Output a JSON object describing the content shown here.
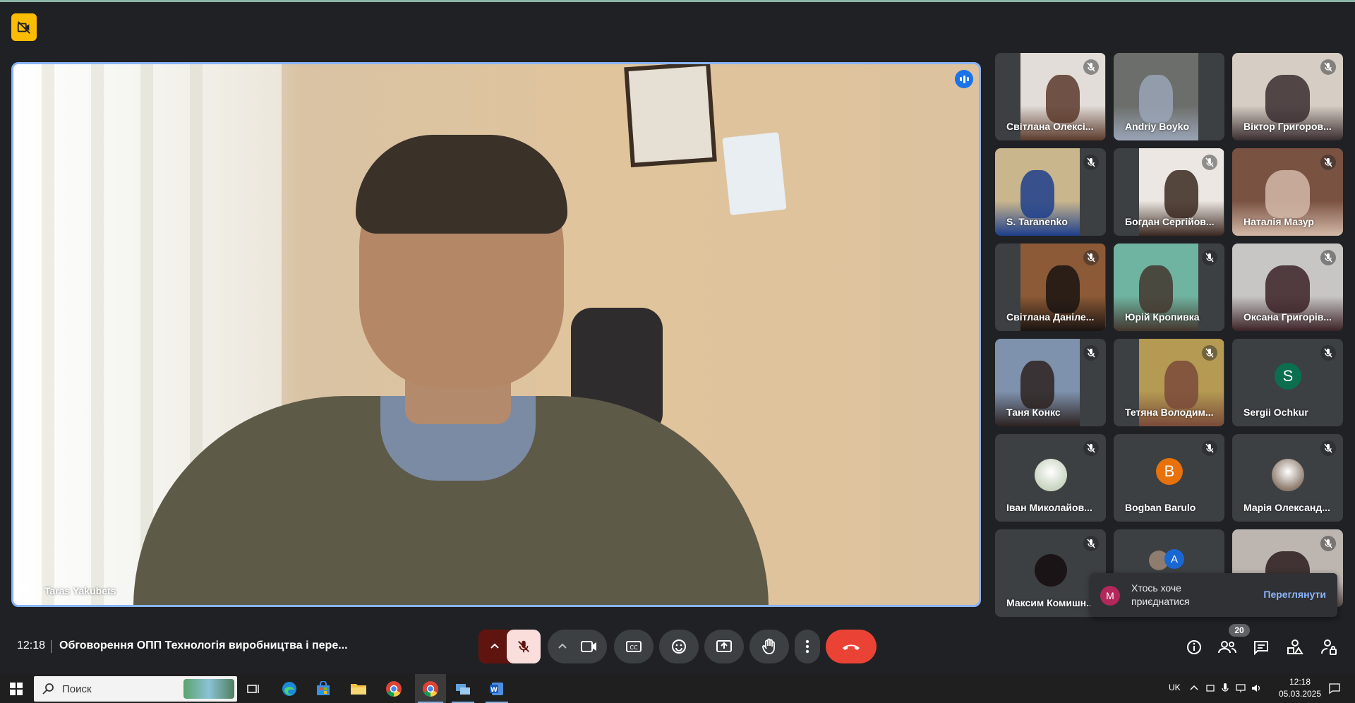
{
  "main_stage": {
    "speaker_name": "Taras Yakubets"
  },
  "participants": [
    {
      "name": "Світлана Олексі...",
      "type": "video",
      "muted": true,
      "bg": "#e2ddd8",
      "fg": "#5b3a2c"
    },
    {
      "name": "Andriy Boyko",
      "type": "video",
      "muted": false,
      "bg": "#6b6e6a",
      "fg": "#9aa4b6"
    },
    {
      "name": "Віктор Григоров...",
      "type": "video",
      "muted": true,
      "bg": "#d6cec4",
      "fg": "#3a2d30"
    },
    {
      "name": "S. Taranenko",
      "type": "video",
      "muted": true,
      "bg": "#c9b68d",
      "fg": "#1e3f8c"
    },
    {
      "name": "Богдан Сергійов...",
      "type": "video",
      "muted": true,
      "bg": "#ece7e2",
      "fg": "#3a2820"
    },
    {
      "name": "Наталія Мазур",
      "type": "video",
      "muted": true,
      "bg": "#7a5242",
      "fg": "#d4b9a8"
    },
    {
      "name": "Світлана Даніле...",
      "type": "video",
      "muted": true,
      "bg": "#8c5a36",
      "fg": "#1a1412"
    },
    {
      "name": "Юрій Кропивка",
      "type": "video",
      "muted": true,
      "bg": "#6fb4a0",
      "fg": "#44362e"
    },
    {
      "name": "Оксана Григорів...",
      "type": "video",
      "muted": true,
      "bg": "#c8c6c5",
      "fg": "#3b2226"
    },
    {
      "name": "Таня Конкс",
      "type": "video",
      "muted": true,
      "bg": "#7e92ad",
      "fg": "#2d2220"
    },
    {
      "name": "Тетяна Володим...",
      "type": "video",
      "muted": true,
      "bg": "#b49a52",
      "fg": "#7a4a3a"
    },
    {
      "name": "Sergii Ochkur",
      "type": "avatar",
      "muted": true,
      "letter": "S",
      "avatar_color": "#0b6e4f"
    },
    {
      "name": "Іван Миколайов...",
      "type": "photo",
      "muted": true,
      "avatar_color": "#c8d4c0"
    },
    {
      "name": "Bogban Barulo",
      "type": "avatar",
      "muted": true,
      "letter": "B",
      "avatar_color": "#e8710a"
    },
    {
      "name": "Марія Олександ...",
      "type": "photo",
      "muted": true,
      "avatar_color": "#8e7c6e"
    },
    {
      "name": "Максим Комишн...",
      "type": "photo",
      "muted": true,
      "avatar_color": "#1b1416"
    },
    {
      "name": "",
      "type": "group",
      "muted": false,
      "letter": "A",
      "avatar_color": "#1967d2"
    },
    {
      "name": "",
      "type": "video",
      "muted": true,
      "bg": "#bdb6b0",
      "fg": "#2b1c1e"
    }
  ],
  "toast": {
    "avatar_letter": "M",
    "message": "Хтось хоче приєднатися",
    "action": "Переглянути"
  },
  "bottom_bar": {
    "time": "12:18",
    "meeting_title": "Обговорення ОПП Технологія виробництва і пере...",
    "participant_count": "20"
  },
  "taskbar": {
    "search_placeholder": "Поиск",
    "language": "UK",
    "clock_time": "12:18",
    "clock_date": "05.03.2025"
  },
  "colors": {
    "accent": "#8ab4f8",
    "end_call": "#ea4335",
    "mic_off_bg": "#f9dedc",
    "present_bg": "#601410"
  }
}
